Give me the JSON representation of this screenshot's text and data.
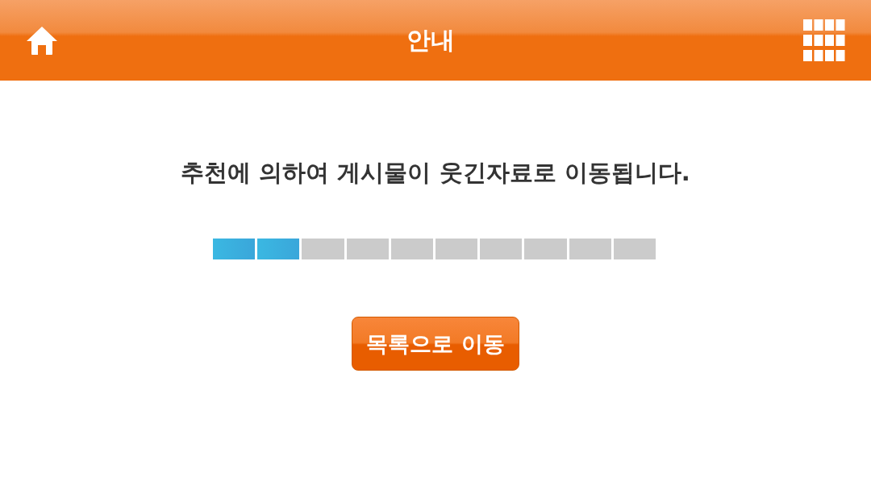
{
  "header": {
    "title": "안내"
  },
  "message": "추천에 의하여 게시물이 웃긴자료로 이동됩니다.",
  "progress": {
    "level": 0.2
  },
  "button": {
    "label": "목록으로 이동"
  }
}
